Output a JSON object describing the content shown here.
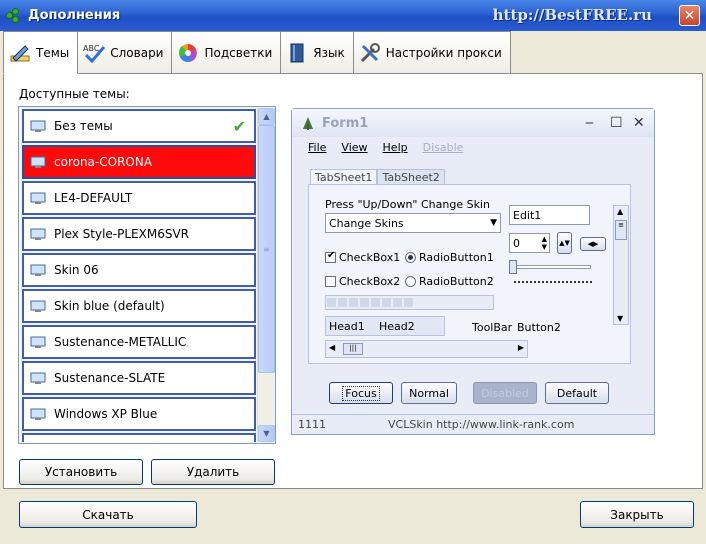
{
  "window": {
    "title": "Дополнения",
    "watermark": "http://BestFREE.ru",
    "close_glyph": "✕"
  },
  "tabs": [
    {
      "label": "Темы",
      "icon": "pencil-ruler-icon"
    },
    {
      "label": "Словари",
      "icon": "abc-check-icon"
    },
    {
      "label": "Подсветки",
      "icon": "color-wheel-icon"
    },
    {
      "label": "Язык",
      "icon": "book-icon"
    },
    {
      "label": "Настройки прокси",
      "icon": "tools-icon"
    }
  ],
  "themes": {
    "label": "Доступные темы:",
    "items": [
      {
        "name": "Без темы",
        "checked": true
      },
      {
        "name": "corona-CORONA",
        "selected": true
      },
      {
        "name": "LE4-DEFAULT"
      },
      {
        "name": "Plex Style-PLEXM6SVR"
      },
      {
        "name": "Skin 06"
      },
      {
        "name": "Skin blue (default)"
      },
      {
        "name": "Sustenance-METALLIC"
      },
      {
        "name": "Sustenance-SLATE"
      },
      {
        "name": "Windows XP Blue"
      }
    ],
    "selected_color": "#ff0a0a"
  },
  "buttons": {
    "install": "Установить",
    "delete": "Удалить",
    "download": "Скачать",
    "close": "Закрыть"
  },
  "preview": {
    "title": "Form1",
    "menu": [
      "File",
      "View",
      "Help",
      "Disable"
    ],
    "tabs": [
      "TabSheet1",
      "TabSheet2"
    ],
    "hint": "Press \"Up/Down\" Change Skin",
    "combo": "Change Skins",
    "edit": "Edit1",
    "spin_value": "0",
    "checkbox1": "CheckBox1",
    "checkbox2": "CheckBox2",
    "radio1": "RadioButton1",
    "radio2": "RadioButton2",
    "head1": "Head1",
    "head2": "Head2",
    "toolbar": "ToolBar",
    "button2": "Button2",
    "btn_focus": "Focus",
    "btn_normal": "Normal",
    "btn_disabled": "Disabled",
    "btn_default": "Default",
    "status_left": "1111",
    "status_right": "VCLSkin http://www.link-rank.com"
  }
}
